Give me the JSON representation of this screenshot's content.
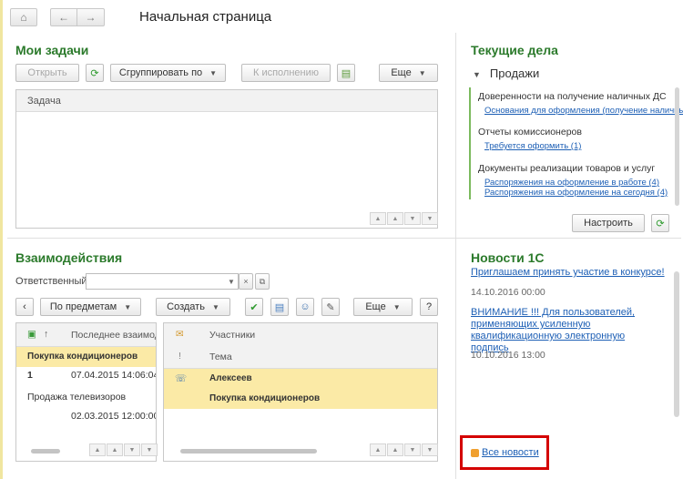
{
  "page": {
    "title": "Начальная страница",
    "icons": {
      "home": "home-icon",
      "back": "arrow-left-icon",
      "forward": "arrow-right-icon"
    }
  },
  "my_tasks": {
    "title": "Мои задачи",
    "buttons": {
      "open": "Открыть",
      "group_by": "Сгруппировать по",
      "to_execution": "К исполнению",
      "more": "Еще"
    },
    "column_task": "Задача"
  },
  "current_affairs": {
    "title": "Текущие дела",
    "group": "Продажи",
    "items": [
      {
        "title": "Доверенности на получение наличных ДС",
        "links": [
          "Основания для оформления (получение наличных..."
        ]
      },
      {
        "title": "Отчеты комиссионеров",
        "links": [
          "Требуется оформить (1)"
        ]
      },
      {
        "title": "Документы реализации товаров и услуг",
        "links": [
          "Распоряжения на оформление в работе (4)",
          "Распоряжения на оформление на сегодня (4)"
        ]
      }
    ],
    "configure": "Настроить"
  },
  "news": {
    "title": "Новости 1С",
    "items": [
      {
        "text": "Приглашаем принять участие в конкурсе!",
        "date": "14.10.2016 00:00"
      },
      {
        "text": "ВНИМАНИЕ !!! Для пользователей, применяющих усиленную квалификационную электронную подпись",
        "date": "10.10.2016 13:00"
      }
    ],
    "all_news": "Все новости"
  },
  "interactions": {
    "title": "Взаимодействия",
    "responsible_label": "Ответственный:",
    "responsible_value": "",
    "buttons": {
      "by_subjects": "По предметам",
      "create": "Создать",
      "more": "Еще",
      "help": "?"
    },
    "left_table": {
      "sort_mark": "↑",
      "col_last": "Последнее взаимод",
      "rows": [
        {
          "name": "Покупка кондиционеров",
          "count": "1",
          "date": "07.04.2015 14:06:04"
        },
        {
          "name": "Продажа телевизоров",
          "count": "",
          "date": "02.03.2015 12:00:00"
        }
      ]
    },
    "right_table": {
      "col_participants": "Участники",
      "col_subject": "Тема",
      "row_participant": "Алексеев",
      "row_subject": "Покупка кондиционеров"
    }
  },
  "colors": {
    "title_green": "#2b7a2b",
    "link_blue": "#1d5fb5",
    "highlight": "#fbeaa6",
    "callout": "#d40000"
  }
}
